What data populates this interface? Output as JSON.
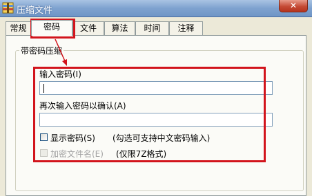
{
  "window": {
    "title": "压缩文件",
    "close_symbol": "✕"
  },
  "tabs": [
    {
      "label": "常规"
    },
    {
      "label": "密码"
    },
    {
      "label": "文件"
    },
    {
      "label": "算法"
    },
    {
      "label": "时间"
    },
    {
      "label": "注释"
    }
  ],
  "password": {
    "group_label": "带密码压缩",
    "enter_label": "输入密码(I)",
    "enter_value": "",
    "confirm_label": "再次输入密码以确认(A)",
    "confirm_value": "",
    "show_password_label": "显示密码(S)",
    "show_password_checked": false,
    "hint": "(勾选可支持中文密码输入)",
    "encrypt_names_label": "加密文件名(E)",
    "encrypt_names_checked": false,
    "encrypt_names_note": "(仅限7Z格式)"
  },
  "colors": {
    "annotation": "#d2141c"
  }
}
